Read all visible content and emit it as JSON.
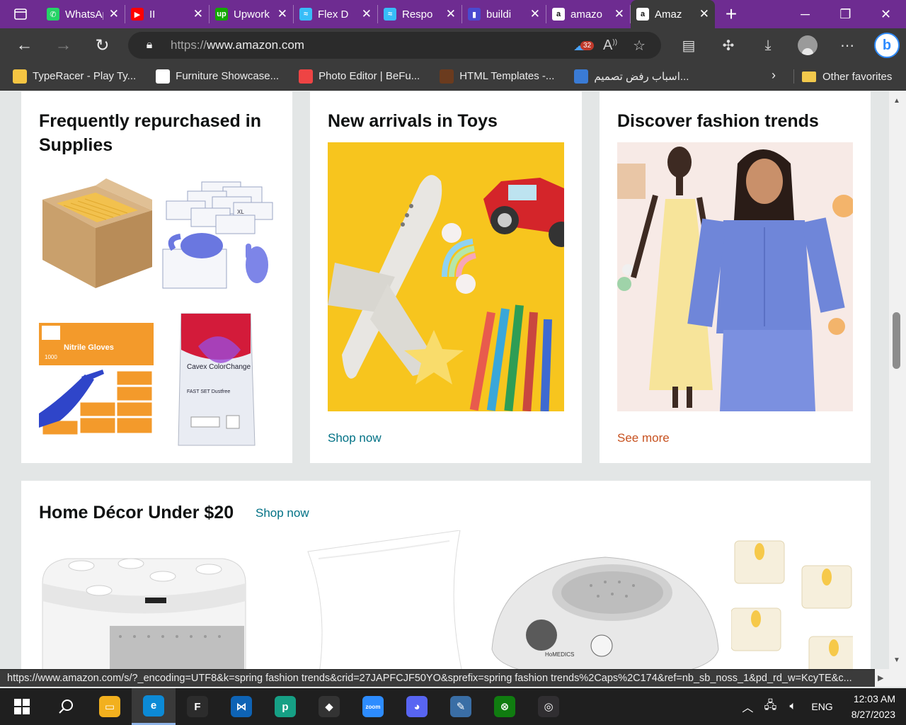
{
  "tabs": [
    {
      "title": "WhatsApp",
      "icon": "whatsapp-icon",
      "color": "#25d366",
      "glyph": "✆"
    },
    {
      "title": "II",
      "icon": "youtube-icon",
      "color": "#ff0000",
      "glyph": "▶"
    },
    {
      "title": "Upwork",
      "icon": "upwork-icon",
      "color": "#14a800",
      "glyph": "up"
    },
    {
      "title": "Flex D",
      "icon": "tailwind-icon",
      "color": "#38bdf8",
      "glyph": "≈"
    },
    {
      "title": "Respo",
      "icon": "tailwind-icon",
      "color": "#38bdf8",
      "glyph": "≈"
    },
    {
      "title": "buildi",
      "icon": "book-icon",
      "color": "#4a4ad0",
      "glyph": "▮"
    },
    {
      "title": "amazo",
      "icon": "amazon-icon",
      "color": "#ffffff",
      "glyph": "a"
    },
    {
      "title": "Amaz",
      "icon": "amazon-icon",
      "color": "#ffffff",
      "glyph": "a",
      "active": true
    }
  ],
  "address": {
    "protocol": "https://",
    "host": "www.amazon.com",
    "tracker_count": "32"
  },
  "bookmarks": [
    {
      "label": "TypeRacer - Play Ty...",
      "icon": "typeracer-icon"
    },
    {
      "label": "Furniture Showcase...",
      "icon": "m-icon"
    },
    {
      "label": "Photo Editor | BeFu...",
      "icon": "befunky-icon"
    },
    {
      "label": "HTML Templates -...",
      "icon": "templates-icon"
    },
    {
      "label": "اسباب رفض تصميم...",
      "icon": "e-icon"
    }
  ],
  "bookmarks_other": "Other favorites",
  "cards": {
    "supplies": {
      "title": "Frequently repurchased in Supplies"
    },
    "toys": {
      "title": "New arrivals in Toys",
      "link": "Shop now"
    },
    "fashion": {
      "title": "Discover fashion trends",
      "link": "See more"
    },
    "decor": {
      "title": "Home Décor Under $20",
      "link": "Shop now"
    }
  },
  "product_text": {
    "gloves_orange": "Nitrile Gloves",
    "gloves_count": "1000",
    "cavex_name": "Cavex ColorChange",
    "cavex_sub": "FAST SET Dustfree",
    "glove_box": "XL",
    "homedics": "HoMEDICS"
  },
  "status_url": "https://www.amazon.com/s/?_encoding=UTF8&k=spring fashion trends&crid=27JAPFCJF50YO&sprefix=spring fashion trends%2Caps%2C174&ref=nb_sb_noss_1&pd_rd_w=KcyTE&c...",
  "taskbar": {
    "apps": [
      {
        "name": "file-explorer",
        "color": "#f2b01e",
        "glyph": "▭"
      },
      {
        "name": "edge",
        "color": "#0c8ad6",
        "glyph": "e",
        "active": true
      },
      {
        "name": "figma",
        "color": "#2c2c2c",
        "glyph": "F"
      },
      {
        "name": "vscode",
        "color": "#0e63b5",
        "glyph": "⋈"
      },
      {
        "name": "pycharm-like",
        "color": "#16a085",
        "glyph": "p"
      },
      {
        "name": "inkscape",
        "color": "#333333",
        "glyph": "◆"
      },
      {
        "name": "zoom",
        "color": "#2d8cff",
        "glyph": "zoom"
      },
      {
        "name": "discord",
        "color": "#5865f2",
        "glyph": "◕"
      },
      {
        "name": "paint",
        "color": "#3a6ea5",
        "glyph": "✎"
      },
      {
        "name": "xbox",
        "color": "#107c10",
        "glyph": "⊗"
      },
      {
        "name": "obs",
        "color": "#302e31",
        "glyph": "◎"
      }
    ],
    "language": "ENG",
    "time": "12:03 AM",
    "date": "8/27/2023"
  }
}
